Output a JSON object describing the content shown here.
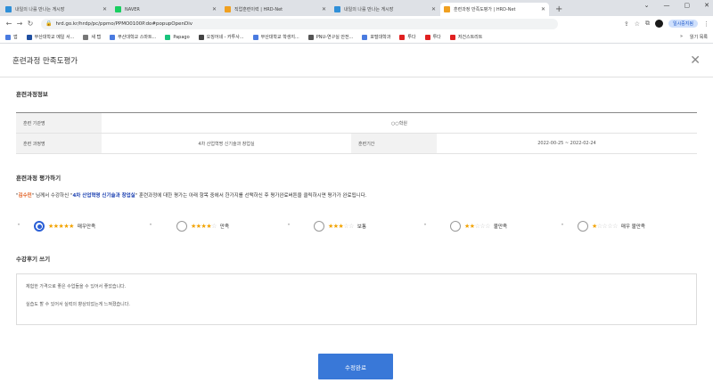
{
  "browser": {
    "tabs": [
      {
        "title": "내일의 나를 만나는 게시장",
        "active": false,
        "color": "#2f8fd8"
      },
      {
        "title": "NAVER",
        "active": false,
        "color": "#19ce60"
      },
      {
        "title": "직업훈련이력 | HRD-Net",
        "active": false,
        "color": "#f0a020"
      },
      {
        "title": "내일의 나를 만나는 게시장",
        "active": false,
        "color": "#2f8fd8"
      },
      {
        "title": "훈련과정 만족도평가 | HRD-Net",
        "active": true,
        "color": "#f0a020"
      }
    ],
    "new_tab": "+",
    "window_controls": [
      "⌄",
      "—",
      "▢",
      "✕"
    ],
    "url": "hrd.go.kr/hrdp/pc/ppmo/PPMO0100P.do#popupOpenDiv",
    "profile_pill": "일시중지됨",
    "bookmarks": [
      {
        "label": "앱",
        "color": "#4a7be0"
      },
      {
        "label": "부산대학교 메일 서...",
        "color": "#1f4fa0"
      },
      {
        "label": "새 탭",
        "color": "#777777"
      },
      {
        "label": "부산대학교 스마트...",
        "color": "#4a7be0"
      },
      {
        "label": "Papago",
        "color": "#19c37d"
      },
      {
        "label": "오징어네 - 카투사...",
        "color": "#444444"
      },
      {
        "label": "부산대학교 학생지...",
        "color": "#4a7be0"
      },
      {
        "label": "PNU-연구실 안전...",
        "color": "#555555"
      },
      {
        "label": "포털대학과",
        "color": "#4a7be0"
      },
      {
        "label": "투다",
        "color": "#e02020"
      },
      {
        "label": "투다",
        "color": "#e02020"
      },
      {
        "label": "저건스트리트",
        "color": "#e02020"
      }
    ],
    "bookmarks_right": [
      "»",
      "읽기 목록"
    ]
  },
  "modal": {
    "title": "훈련과정 만족도평가",
    "close": "✕",
    "info_section_title": "훈련과정정보",
    "info": {
      "org_label": "훈련 기관명",
      "org_value": "○○학원",
      "course_label": "훈련 과정명",
      "course_value": "4차 산업혁명 신기술과 창업실",
      "period_label": "훈련기간",
      "period_value": "2022-00-25 ~ 2022-02-24"
    },
    "eval_section_title": "훈련과정 평가하기",
    "instruction": {
      "q1": "\"",
      "name": "김수민",
      "part1": "\" 님께서 수강하신 \"",
      "course": "4차 산업혁명 신기술과 창업실",
      "part2": "\" 훈련과정에 대한 평가는 아래 항목 중에서 한가지를 선택하신 후 평가완료버튼을 클릭하시면 평가가 완료됩니다."
    },
    "ratings": [
      {
        "on": "★★★★★",
        "off": "",
        "label": "매우만족",
        "selected": true
      },
      {
        "on": "★★★★",
        "off": "☆",
        "label": "만족",
        "selected": false
      },
      {
        "on": "★★★",
        "off": "☆☆",
        "label": "보통",
        "selected": false
      },
      {
        "on": "★★",
        "off": "☆☆☆",
        "label": "불만족",
        "selected": false
      },
      {
        "on": "★",
        "off": "☆☆☆☆",
        "label": "매우 불만족",
        "selected": false
      }
    ],
    "rating_level": 5,
    "review_section_title": "수강후기 쓰기",
    "review_lines": [
      "체험한 가격으로 좋은 수업들을 수 있어서 좋았습니다.",
      "실습도 할 수 있어서 실력의 향상되었는게 느껴졌습니다."
    ],
    "submit_label": "수정완료"
  },
  "colors": {
    "accent": "#3978d8",
    "name_highlight": "#e05a1a",
    "course_highlight": "#1a3fb0",
    "star": "#f2a300"
  }
}
